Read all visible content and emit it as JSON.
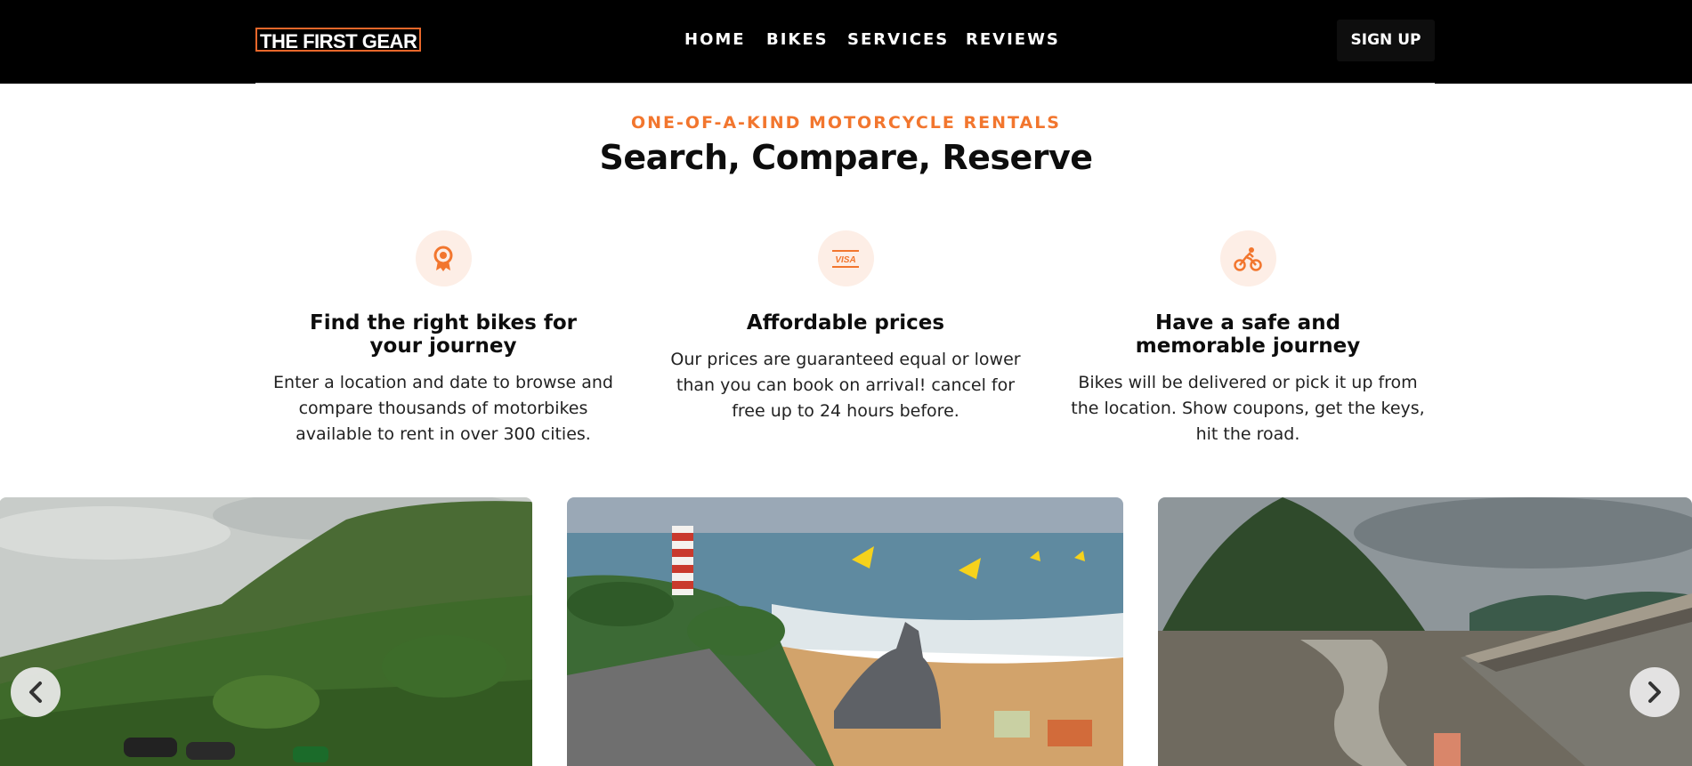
{
  "header": {
    "logo_text": "THE FIRST GEAR",
    "nav": [
      {
        "label": "HOME"
      },
      {
        "label": "BIKES"
      },
      {
        "label": "SERVICES"
      },
      {
        "label": "REVIEWS"
      }
    ],
    "signup_label": "SIGN UP"
  },
  "hero": {
    "eyebrow": "ONE-OF-A-KIND MOTORCYCLE RENTALS",
    "title": "Search, Compare, Reserve"
  },
  "features": [
    {
      "icon": "award-ribbon-icon",
      "title": "Find the right bikes for your journey",
      "text": "Enter a location and date to browse and compare thousands of motorbikes available to rent in over 300 cities."
    },
    {
      "icon": "visa-card-icon",
      "title": "Affordable prices",
      "text": "Our prices are guaranteed equal or lower than you can book on arrival! cancel for free up to 24 hours before."
    },
    {
      "icon": "bicycle-rider-icon",
      "title": "Have a safe and memorable journey",
      "text": "Bikes will be delivered or pick it up from the location. Show coupons, get the keys, hit the road."
    }
  ],
  "carousel": {
    "slides": [
      {
        "subject": "forested-hill-with-parked-bikes"
      },
      {
        "subject": "beach-road-with-lighthouse-and-submarine"
      },
      {
        "subject": "river-dam-with-hill"
      }
    ],
    "prev_icon": "chevron-left-icon",
    "next_icon": "chevron-right-icon"
  },
  "colors": {
    "accent": "#f2762e",
    "header_bg": "#000000",
    "icon_bg": "#fdeee6"
  }
}
